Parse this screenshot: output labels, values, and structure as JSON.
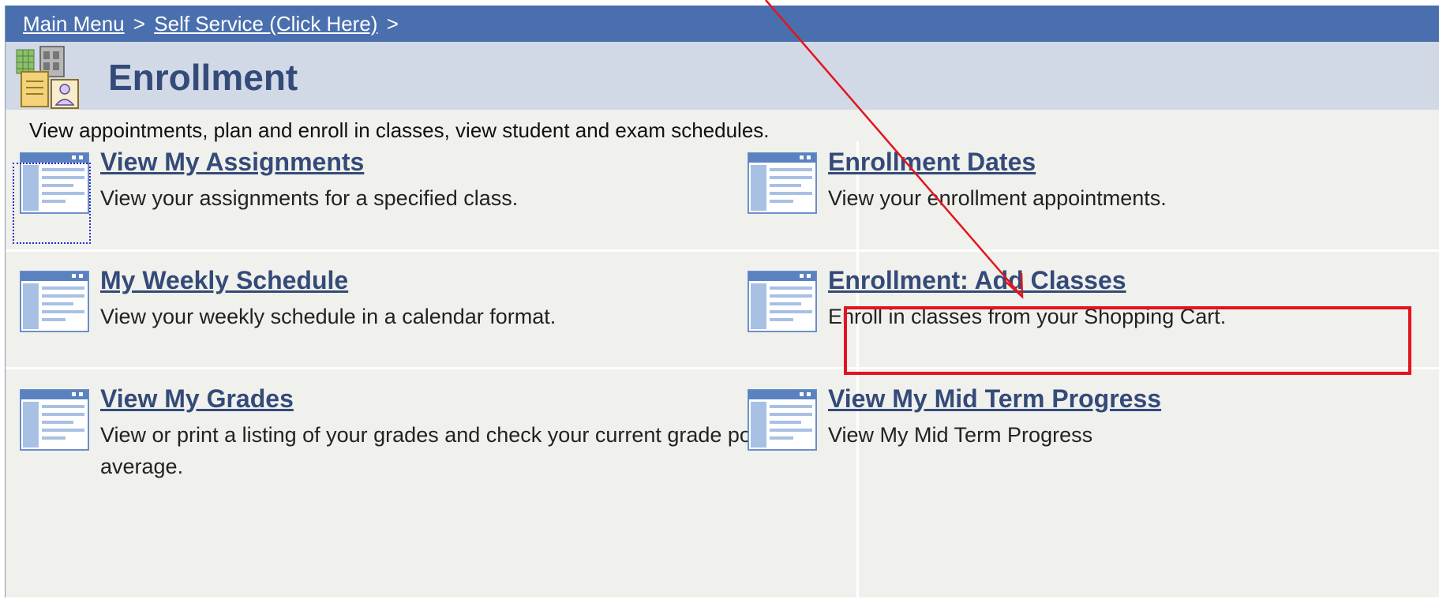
{
  "breadcrumb": {
    "main_menu": "Main Menu",
    "self_service": "Self Service (Click Here)",
    "separator": ">"
  },
  "page": {
    "title": "Enrollment",
    "intro": "View appointments, plan and enroll in classes, view student and exam schedules."
  },
  "tiles": [
    {
      "title": "View My Assignments",
      "desc": "View your assignments for a specified class."
    },
    {
      "title": "Enrollment Dates",
      "desc": "View your enrollment appointments."
    },
    {
      "title": "My Weekly Schedule",
      "desc": "View your weekly schedule in a calendar format."
    },
    {
      "title": "Enrollment: Add Classes",
      "desc": "Enroll in classes from your Shopping Cart."
    },
    {
      "title": "View My Grades",
      "desc": "View or print a listing of your grades and check your current grade point average."
    },
    {
      "title": "View My Mid Term Progress",
      "desc": "View My Mid Term Progress"
    }
  ],
  "icons": {
    "page_icon": "enrollment-folder-icon",
    "tile_icon": "window-page-icon"
  },
  "colors": {
    "breadcrumb_bg": "#4a6fae",
    "title_bg": "#d1d9e6",
    "link": "#344a79",
    "annotation_red": "#e3141e"
  }
}
